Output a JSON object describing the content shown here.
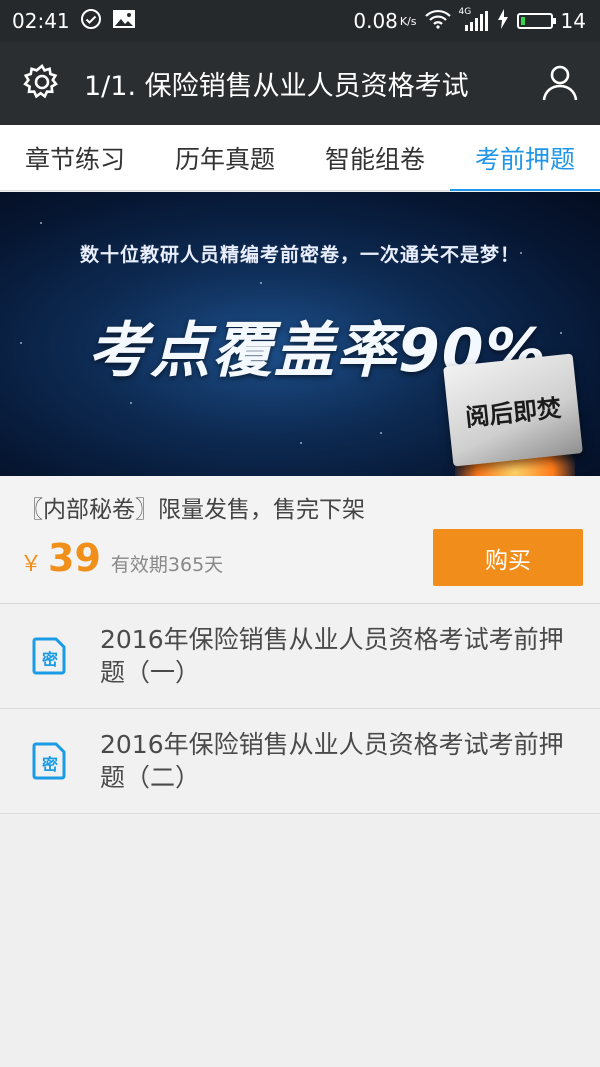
{
  "status_bar": {
    "time": "02:41",
    "speed": "0.08",
    "speed_unit": "K/s",
    "network": "4G",
    "battery": "14",
    "battery_level": 0.14
  },
  "app_bar": {
    "title": "1/1. 保险销售从业人员资格考试",
    "left_icon": "gear-icon",
    "right_icon": "user-icon"
  },
  "tabs": [
    {
      "label": "章节练习",
      "active": false
    },
    {
      "label": "历年真题",
      "active": false
    },
    {
      "label": "智能组卷",
      "active": false
    },
    {
      "label": "考前押题",
      "active": true
    }
  ],
  "banner": {
    "subtitle": "数十位教研人员精编考前密卷，一次通关不是梦！",
    "headline": "考点覆盖率90%",
    "seal": "阅后即焚"
  },
  "product": {
    "description": "〖内部秘卷〗限量发售，售完下架",
    "currency": "￥",
    "price": "39",
    "validity": "有效期365天",
    "buy_label": "购买"
  },
  "papers": [
    {
      "title": "2016年保险销售从业人员资格考试考前押题（一）",
      "icon": "secret-icon",
      "icon_text": "密"
    },
    {
      "title": "2016年保险销售从业人员资格考试考前押题（二）",
      "icon": "secret-icon",
      "icon_text": "密"
    }
  ],
  "colors": {
    "accent_blue": "#2196e8",
    "accent_orange": "#f18d1a",
    "app_bar": "#2b2e31"
  }
}
